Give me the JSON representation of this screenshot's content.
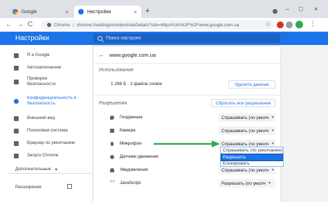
{
  "tabs": [
    {
      "title": "Google",
      "close": "×"
    },
    {
      "title": "Настройки",
      "close": "×"
    }
  ],
  "new_tab": "+",
  "window": {
    "minimize": "–",
    "maximize": "□",
    "close": "×"
  },
  "nav": {
    "back": "←",
    "forward": "→",
    "reload": "C"
  },
  "omnibox": {
    "scheme_label": "Chrome",
    "separator": "|",
    "url": "chrome://settings/content/siteDetails?site=https%3A%2F%2Fwww.google.com.ua"
  },
  "toolbar": {
    "star": "☆",
    "menu": "⋮"
  },
  "header": {
    "title": "Настройки",
    "search_placeholder": "Поиск настроек"
  },
  "sidebar": {
    "items": [
      {
        "label": "Я и Google"
      },
      {
        "label": "Автозаполнение"
      },
      {
        "label": "Проверка безопасности"
      },
      {
        "label": "Конфиденциальность и безопасность"
      },
      {
        "label": "Внешний вид"
      },
      {
        "label": "Поисковая система"
      },
      {
        "label": "Браузер по умолчанию"
      },
      {
        "label": "Запуск Chrome"
      }
    ],
    "advanced": "Дополнительные",
    "advanced_caret": "▾",
    "extensions": "Расширения"
  },
  "site": {
    "url": "www.google.com.ua",
    "usage_title": "Использование",
    "usage_text": "1 298 Б · 2 файла cookie",
    "clear_button": "Удалить данные",
    "permissions_title": "Разрешения",
    "reset_button": "Сбросить все разрешения"
  },
  "permissions": [
    {
      "label": "Геоданные",
      "value": "Спрашивать (по умолч",
      "icon": "location-icon"
    },
    {
      "label": "Камера",
      "value": "Спрашивать (по умолч",
      "icon": "camera-icon"
    },
    {
      "label": "Микрофон",
      "value": "Спрашивать (по умолч",
      "icon": "microphone-icon"
    },
    {
      "label": "Датчики движения",
      "value": "",
      "icon": "motion-sensor-icon"
    },
    {
      "label": "Уведомления",
      "value": "Спрашивать (по умолч",
      "icon": "notification-icon"
    },
    {
      "label": "JavaScript",
      "value": "Разрешать (по умолч",
      "icon": "code-icon"
    }
  ],
  "dropdown": {
    "options": [
      "Спрашивать (по умолчанию)",
      "Разрешить",
      "Блокировать"
    ],
    "selected_index": 1
  },
  "colors": {
    "accent": "#1a73e8",
    "arrow": "#34a853"
  }
}
